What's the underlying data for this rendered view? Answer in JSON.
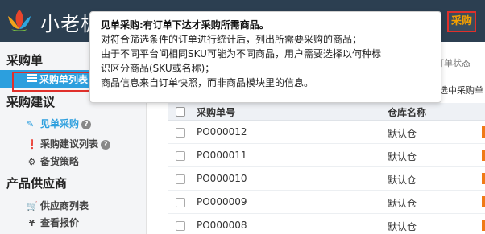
{
  "header": {
    "logo_text": "小老板",
    "nav_button": "采购",
    "accent": "#f5a000"
  },
  "sidebar": {
    "group_purchase_order": "采购单",
    "active_item": "采购单列表",
    "group_purchase_suggest": "采购建议",
    "item_single_purchase": "见单采购",
    "item_suggest_list": "采购建议列表",
    "item_stock_strategy": "备货策略",
    "group_supplier": "产品供应商",
    "item_supplier_list": "供应商列表",
    "item_view_quote": "查看报价"
  },
  "main": {
    "filter_partial": "订单状态",
    "select_partial": "选中采购单",
    "columns": [
      "采购单号",
      "仓库名称"
    ],
    "rows": [
      {
        "po": "PO000012",
        "warehouse": "默认仓"
      },
      {
        "po": "PO000011",
        "warehouse": "默认仓"
      },
      {
        "po": "PO000010",
        "warehouse": "默认仓"
      },
      {
        "po": "PO000009",
        "warehouse": "默认仓"
      },
      {
        "po": "PO000008",
        "warehouse": "默认仓"
      }
    ]
  },
  "tooltip": {
    "title": "见单采购:有订单下达才采购所需商品。",
    "lines": [
      "对符合筛选条件的订单进行统计后，列出所需要采购的商品；",
      "由于不同平台间相同SKU可能为不同商品，用户需要选择以何种标",
      "识区分商品(SKU或名称)；",
      "商品信息来自订单快照，而非商品模块里的信息。"
    ]
  }
}
